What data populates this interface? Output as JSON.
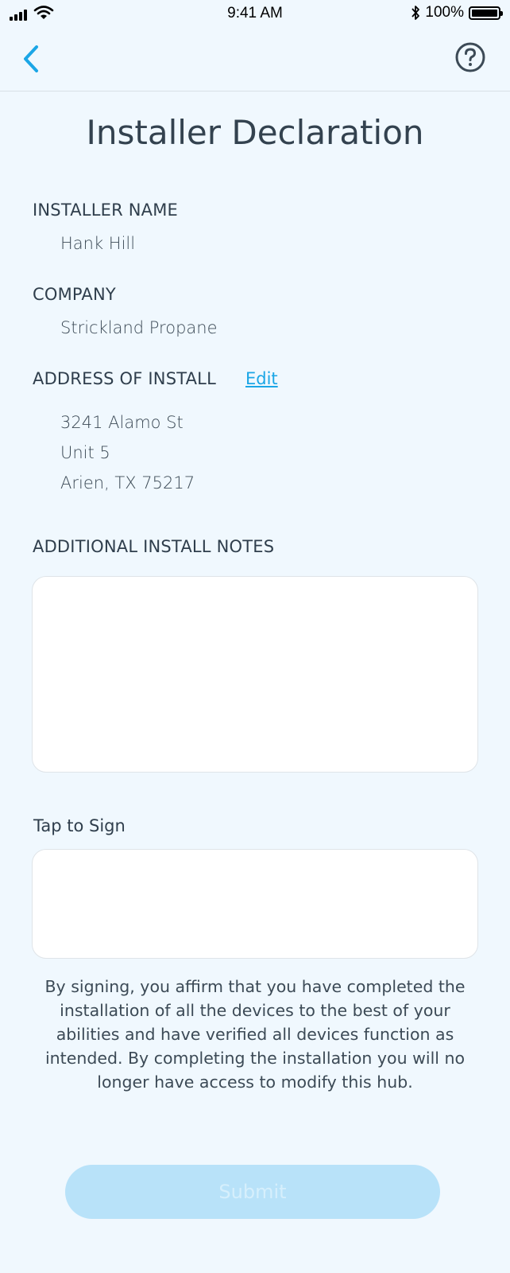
{
  "status_bar": {
    "time": "9:41 AM",
    "battery_text": "100%",
    "battery_level": 1.0,
    "icons": [
      "signal-icon",
      "wifi-icon",
      "bluetooth-icon",
      "battery-icon"
    ]
  },
  "nav": {
    "back_icon": "chevron-left-icon",
    "help_icon": "question-circle-icon",
    "accent_color": "#1ba6e6"
  },
  "page": {
    "title": "Installer Declaration"
  },
  "installer": {
    "name_label": "INSTALLER NAME",
    "name": "Hank Hill",
    "company_label": "COMPANY",
    "company": "Strickland Propane",
    "address_label": "ADDRESS OF INSTALL",
    "edit_label": "Edit",
    "address_lines": [
      "3241 Alamo St",
      "Unit 5",
      "Arien, TX 75217"
    ]
  },
  "notes": {
    "label": "ADDITIONAL INSTALL NOTES",
    "value": ""
  },
  "signature": {
    "label": "Tap to Sign",
    "disclaimer": "By signing, you affirm that you have completed the installation of all the devices to the best of your abilities and have verified all devices function as intended. By completing the installation you will no longer have access to modify this hub."
  },
  "submit": {
    "label": "Submit",
    "state": "disabled",
    "color": "#b8e2f9"
  }
}
